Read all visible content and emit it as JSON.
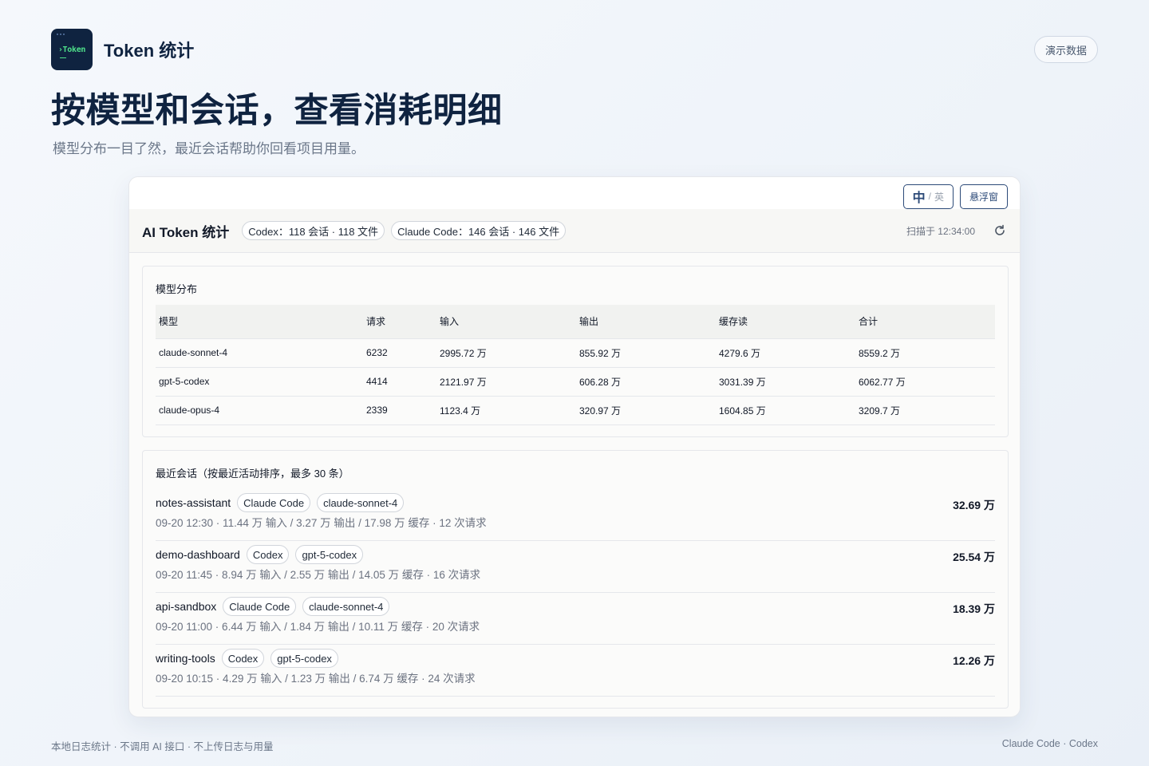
{
  "app": {
    "logo_text": "›Token",
    "title": "Token 统计",
    "demo_button": "演示数据"
  },
  "hero": {
    "headline": "按模型和会话，查看消耗明细",
    "subheadline": "模型分布一目了然，最近会话帮助你回看项目用量。"
  },
  "toolbar": {
    "lang_active": "中",
    "lang_sep": "/",
    "lang_inactive": "英",
    "float_window": "悬浮窗"
  },
  "header": {
    "title": "AI Token 统计",
    "pills": [
      "Codex：118 会话 · 118 文件",
      "Claude Code：146 会话 · 146 文件"
    ],
    "scan_time": "扫描于 12:34:00"
  },
  "models": {
    "title": "模型分布",
    "columns": [
      "模型",
      "请求",
      "输入",
      "输出",
      "缓存读",
      "合计"
    ],
    "rows": [
      [
        "claude-sonnet-4",
        "6232",
        "2995.72 万",
        "855.92 万",
        "4279.6 万",
        "8559.2 万"
      ],
      [
        "gpt-5-codex",
        "4414",
        "2121.97 万",
        "606.28 万",
        "3031.39 万",
        "6062.77 万"
      ],
      [
        "claude-opus-4",
        "2339",
        "1123.4 万",
        "320.97 万",
        "1604.85 万",
        "3209.7 万"
      ]
    ]
  },
  "sessions": {
    "title": "最近会话（按最近活动排序，最多 30 条）",
    "items": [
      {
        "name": "notes-assistant",
        "source": "Claude Code",
        "model": "claude-sonnet-4",
        "meta": "09-20 12:30 · 11.44 万 输入 / 3.27 万 输出 / 17.98 万 缓存 · 12 次请求",
        "total": "32.69 万"
      },
      {
        "name": "demo-dashboard",
        "source": "Codex",
        "model": "gpt-5-codex",
        "meta": "09-20 11:45 · 8.94 万 输入 / 2.55 万 输出 / 14.05 万 缓存 · 16 次请求",
        "total": "25.54 万"
      },
      {
        "name": "api-sandbox",
        "source": "Claude Code",
        "model": "claude-sonnet-4",
        "meta": "09-20 11:00 · 6.44 万 输入 / 1.84 万 输出 / 10.11 万 缓存 · 20 次请求",
        "total": "18.39 万"
      },
      {
        "name": "writing-tools",
        "source": "Codex",
        "model": "gpt-5-codex",
        "meta": "09-20 10:15 · 4.29 万 输入 / 1.23 万 输出 / 6.74 万 缓存 · 24 次请求",
        "total": "12.26 万"
      }
    ]
  },
  "footer": {
    "left": "本地日志统计 · 不调用 AI 接口 · 不上传日志与用量",
    "right": "Claude Code · Codex"
  },
  "colors": {
    "brand_navy": "#0f2340",
    "logo_accent": "#4ee08a",
    "button_border": "#2c4a78"
  },
  "icons": [
    "terminal-logo-icon",
    "refresh-icon"
  ]
}
